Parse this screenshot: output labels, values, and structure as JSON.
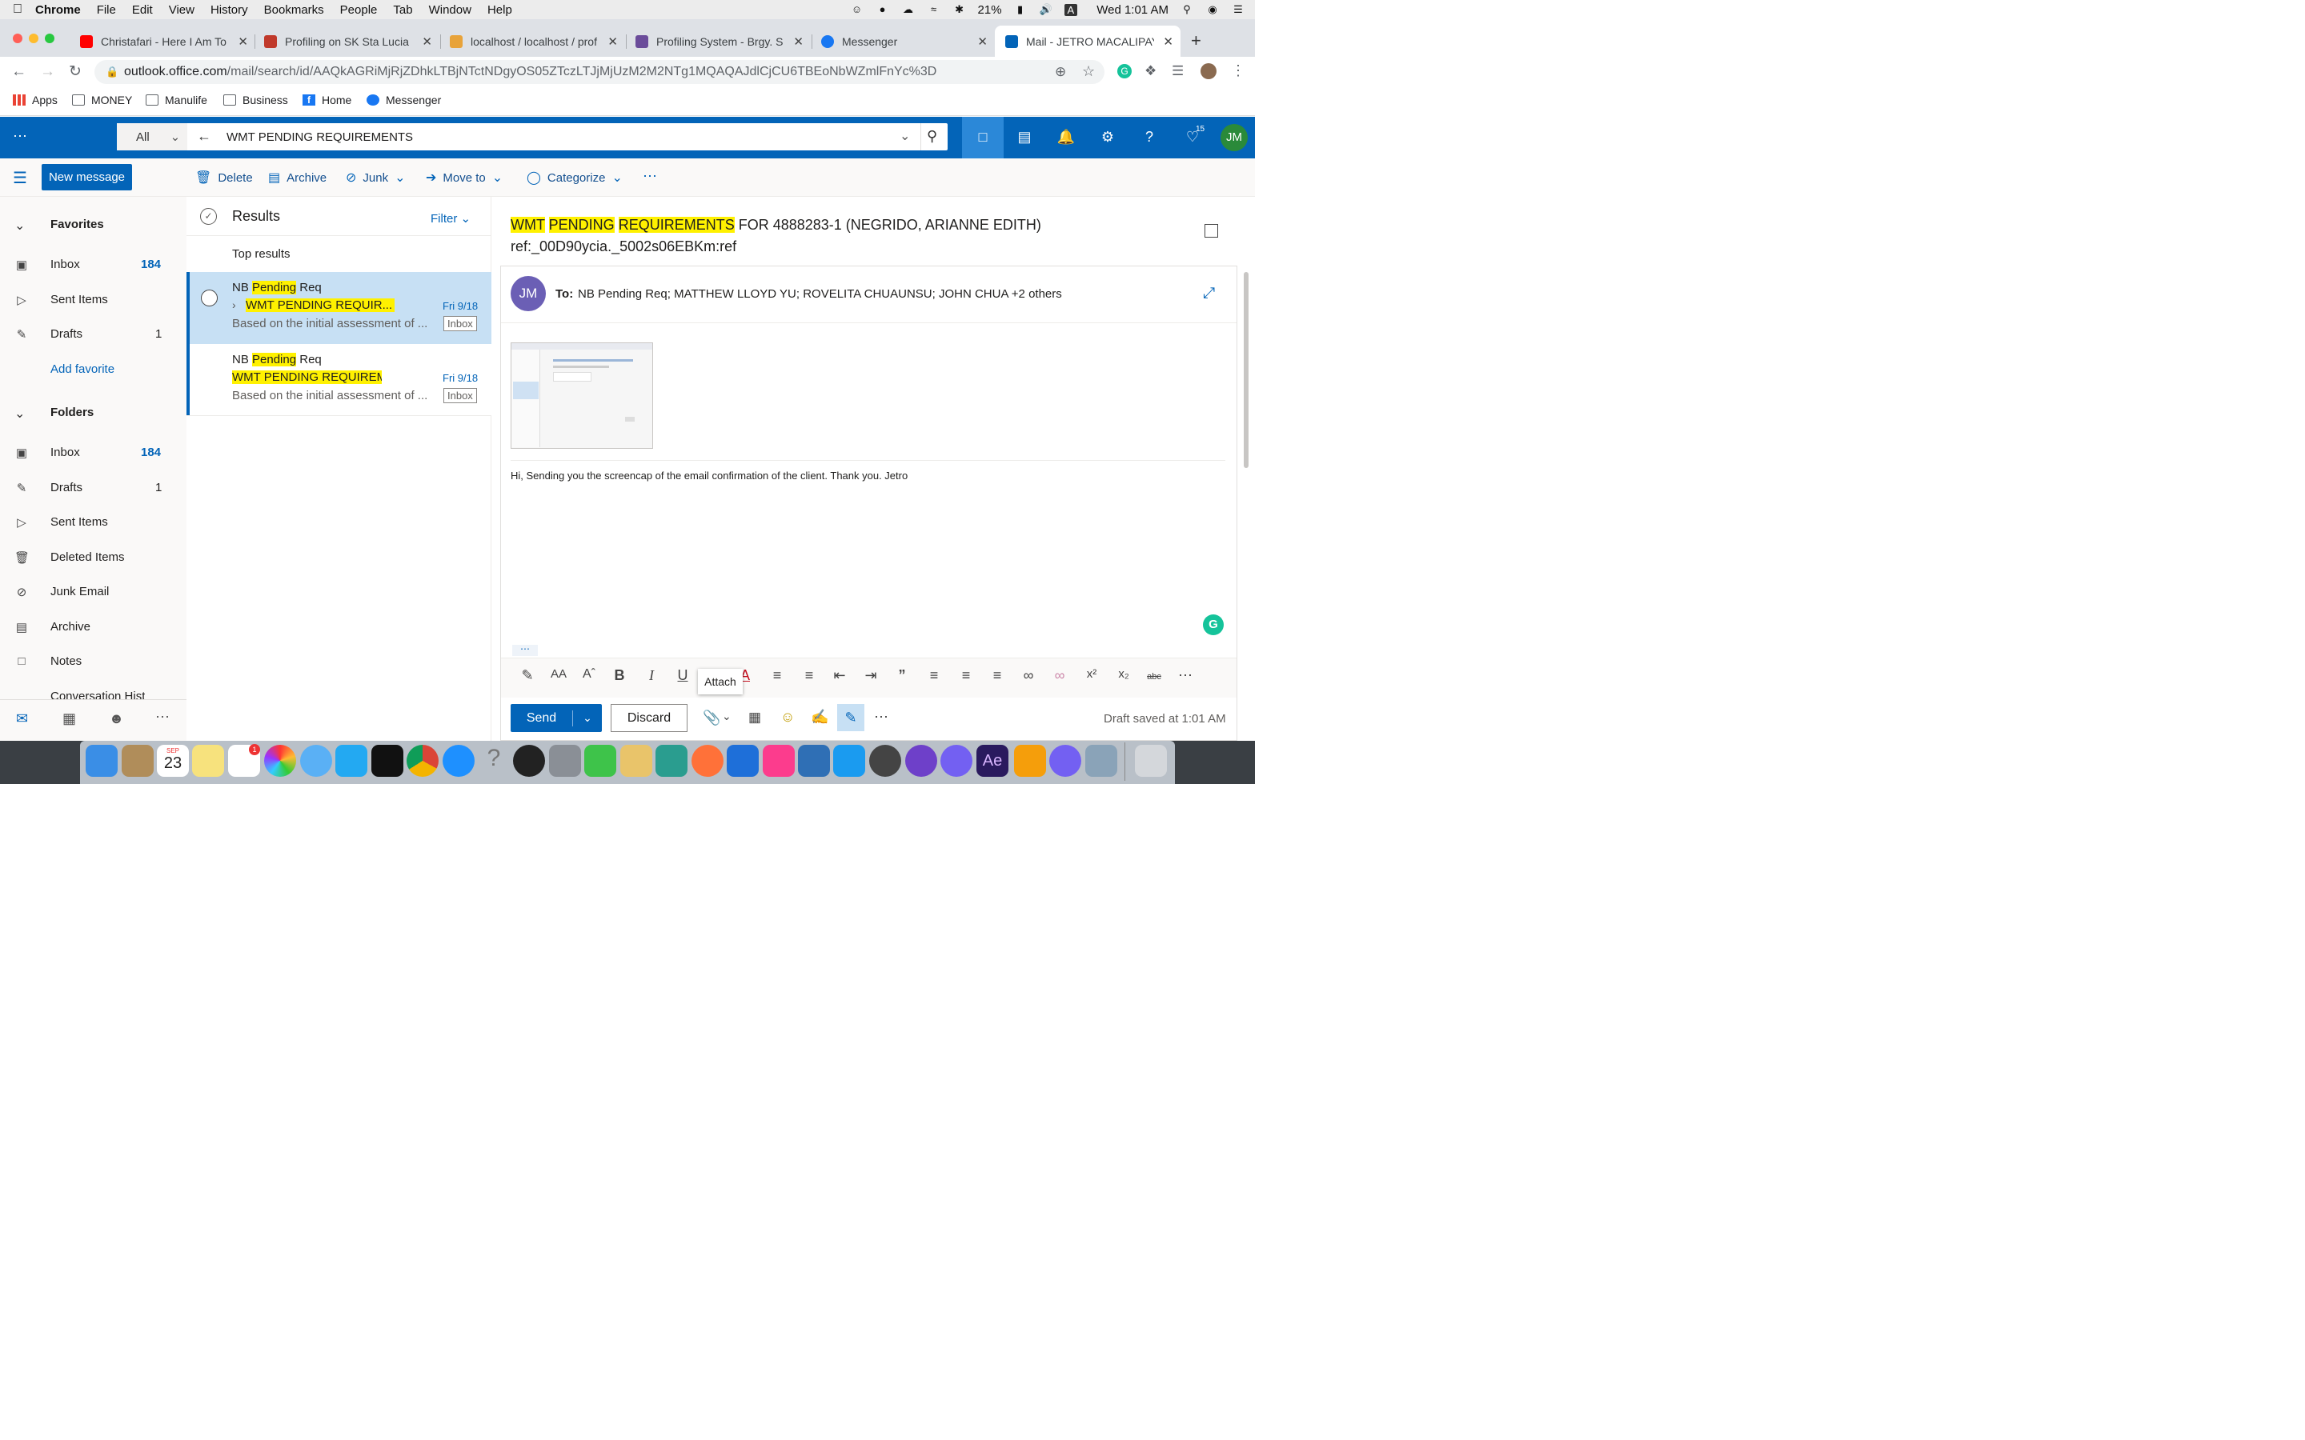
{
  "menubar": {
    "app": "Chrome",
    "items": [
      "File",
      "Edit",
      "View",
      "History",
      "Bookmarks",
      "People",
      "Tab",
      "Window",
      "Help"
    ],
    "battery": "21%",
    "input": "A",
    "clock": "Wed 1:01 AM"
  },
  "tabs": [
    {
      "title": "Christafari - Here I Am To",
      "color": "#ff0000"
    },
    {
      "title": "Profiling on SK Sta Lucia |",
      "color": "#c0392b"
    },
    {
      "title": "localhost / localhost / prof",
      "color": "#e8a33a"
    },
    {
      "title": "Profiling System - Brgy. S",
      "color": "#6b4c9a"
    },
    {
      "title": "Messenger",
      "color": "#1877f2"
    },
    {
      "title": "Mail - JETRO MACALIPAY",
      "color": "#0364b8"
    }
  ],
  "address": {
    "host": "outlook.office.com",
    "path": "/mail/search/id/AAQkAGRiMjRjZDhkLTBjNTctNDgyOS05ZTczLTJjMjUzM2M2NTg1MQAQAJdlCjCU6TBEoNbWZmlFnYc%3D"
  },
  "bookmarks": [
    "Apps",
    "MONEY",
    "Manulife",
    "Business",
    "Home",
    "Messenger"
  ],
  "search": {
    "scope": "All",
    "query": "WMT PENDING REQUIREMENTS",
    "notification_count": "15",
    "avatar": "JM"
  },
  "commands": {
    "new_message": "New message",
    "delete": "Delete",
    "archive": "Archive",
    "junk": "Junk",
    "move_to": "Move to",
    "categorize": "Categorize"
  },
  "nav": {
    "favorites": "Favorites",
    "folders": "Folders",
    "fav_items": [
      {
        "label": "Inbox",
        "count": "184"
      },
      {
        "label": "Sent Items",
        "count": ""
      },
      {
        "label": "Drafts",
        "count": "1"
      }
    ],
    "add_favorite": "Add favorite",
    "folder_items": [
      {
        "label": "Inbox",
        "count": "184"
      },
      {
        "label": "Drafts",
        "count": "1"
      },
      {
        "label": "Sent Items",
        "count": ""
      },
      {
        "label": "Deleted Items",
        "count": ""
      },
      {
        "label": "Junk Email",
        "count": ""
      },
      {
        "label": "Archive",
        "count": ""
      },
      {
        "label": "Notes",
        "count": ""
      },
      {
        "label": "Conversation Hist",
        "count": ""
      }
    ]
  },
  "results": {
    "title": "Results",
    "filter": "Filter",
    "section": "Top results",
    "messages": [
      {
        "from_a": "NB ",
        "from_hl": "Pending",
        "from_b": " Req",
        "subj_1": "WMT",
        "subj_2": "PENDING",
        "subj_3": "REQUIR...",
        "date": "Fri 9/18",
        "preview": "Based on the initial assessment of ...",
        "folder": "Inbox"
      },
      {
        "from_a": "NB ",
        "from_hl": "Pending",
        "from_b": " Req",
        "subj_1": "WMT",
        "subj_2": "PENDING",
        "subj_3": "REQUIREM...",
        "date": "Fri 9/18",
        "preview": "Based on the initial assessment of ...",
        "folder": "Inbox"
      }
    ]
  },
  "reading": {
    "subject_hl": [
      "WMT",
      "PENDING",
      "REQUIREMENTS"
    ],
    "subject_rest": " FOR 4888283-1 (NEGRIDO, ARIANNE EDITH)",
    "subject_ref": "ref:_00D90ycia._5002s06EBKm:ref",
    "sender_initials": "JM",
    "to_label": "To:",
    "to_value": "NB Pending Req; MATTHEW LLOYD YU; ROVELITA CHUAUNSU; JOHN CHUA +2 others",
    "body": "Hi, Sending you the screencap of the email confirmation of the client. Thank you. Jetro",
    "tooltip": "Attach",
    "send": "Send",
    "discard": "Discard",
    "status": "Draft saved at 1:01 AM"
  },
  "dock": {
    "calendar_month": "SEP",
    "calendar_day": "23",
    "reminder_badge": "1"
  }
}
